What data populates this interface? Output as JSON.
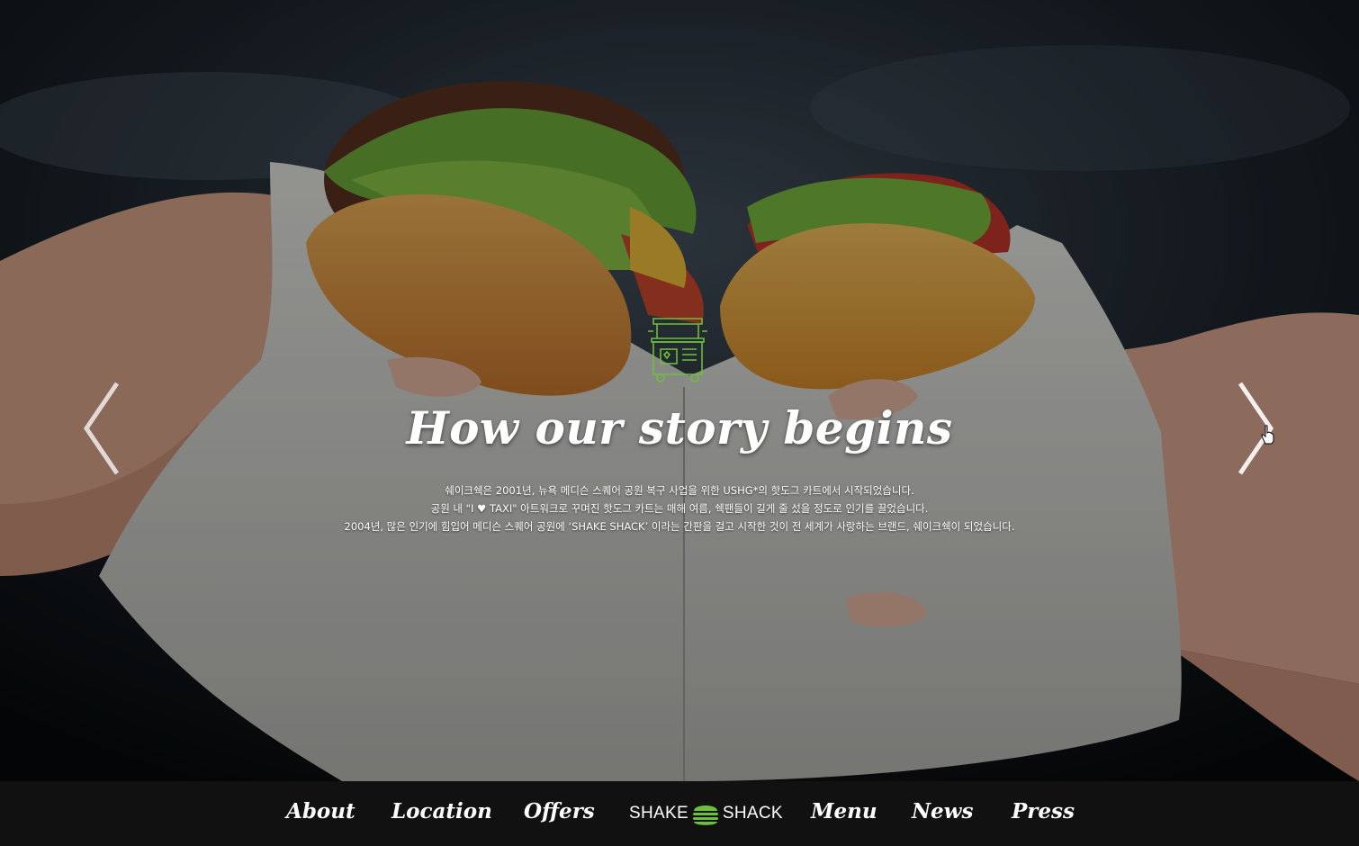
{
  "hero": {
    "headline": "How our story begins",
    "description": [
      "쉐이크쉑은 2001년, 뉴욕 메디슨 스퀘어 공원 복구 사업을 위한 USHG*의 핫도그 카트에서 시작되었습니다.",
      "공원 내 \"I ♥ TAXI\" 아트워크로 꾸며진 핫도그 카트는 매해 여름, 쉑팬들이 길게 줄 섰을 정도로 인기를 끌었습니다.",
      "2004년, 많은 인기에 힘입어 메디슨 스퀘어 공원에 ‘SHAKE SHACK’ 이라는 간판을 걸고 시작한 것이 전 세계가 사랑하는 브랜드, 쉐이크쉑이 되었습니다."
    ],
    "icons": {
      "cart": "hotdog-cart-icon",
      "prev": "chevron-left-icon",
      "next": "chevron-right-icon"
    }
  },
  "nav": {
    "items_left": [
      "About",
      "Location",
      "Offers"
    ],
    "items_right": [
      "Menu",
      "News",
      "Press"
    ],
    "logo_left": "SHAKE",
    "logo_right": "SHACK"
  },
  "colors": {
    "accent_green": "#6dbf3b",
    "nav_bg": "#111111",
    "text": "#ffffff"
  }
}
